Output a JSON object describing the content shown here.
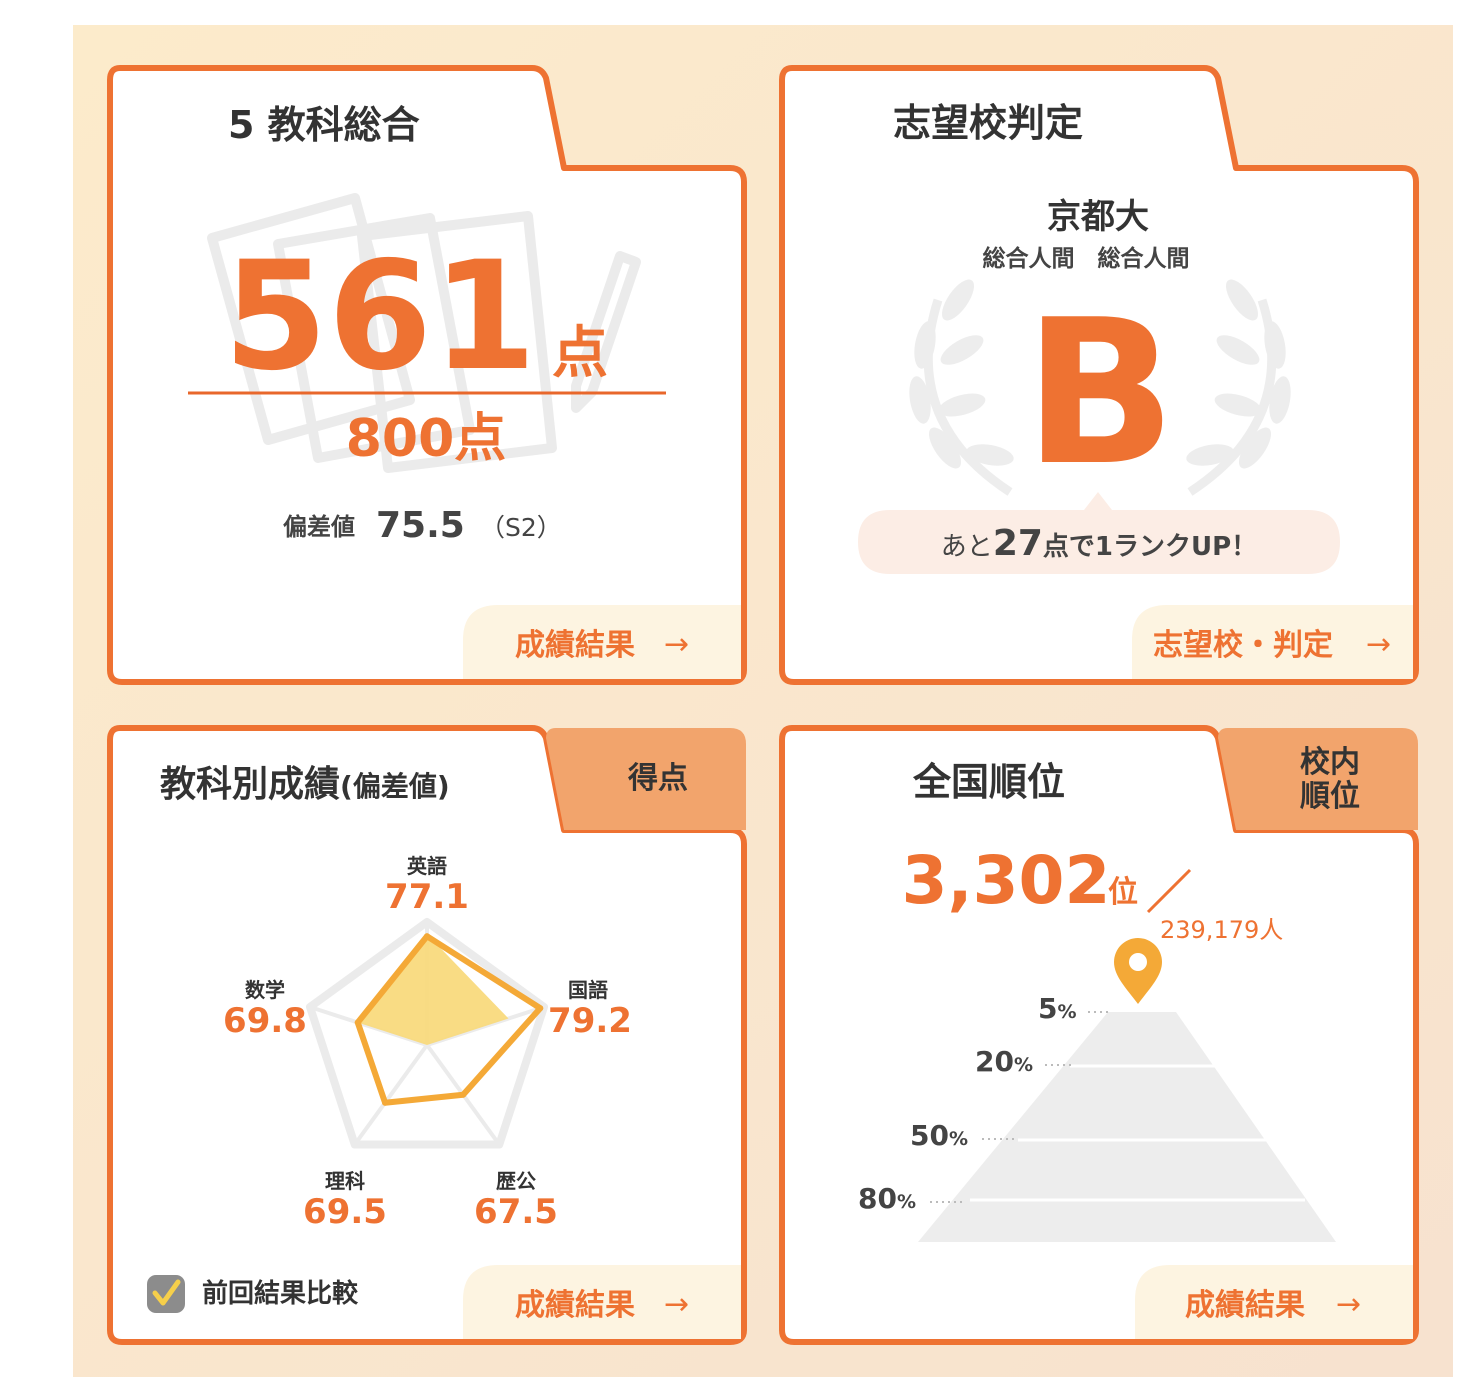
{
  "colors": {
    "accent": "#EE7232",
    "accent_dark": "#E8672B",
    "tab_fill": "#F2A46C",
    "bg": "#FAE9CF",
    "bubble": "#FCEDE5",
    "link_bg": "#FDF4E1",
    "radar_fill": "#F9DA7D",
    "radar_line": "#F4A937",
    "gray": "#EBEBEB"
  },
  "cards": {
    "total": {
      "title": "5 教科総合",
      "score": "561",
      "score_unit": "点",
      "max": "800点",
      "deviation_label": "偏差値",
      "deviation_value": "75.5",
      "rank_code": "（S2）",
      "link": "成績結果",
      "arrow": "→"
    },
    "school": {
      "title": "志望校判定",
      "school_name": "京都大",
      "faculty": "総合人間　総合人間",
      "grade": "B",
      "rank_up_pre": "あと",
      "rank_up_points": "27",
      "rank_up_post": "点で1ランクUP！",
      "link": "志望校・判定",
      "arrow": "→"
    },
    "subjects": {
      "title": "教科別成績",
      "title_sub": "(偏差値)",
      "tab": "得点",
      "compare_label": "前回結果比較",
      "compare_checked": true,
      "link": "成績結果",
      "arrow": "→"
    },
    "ranking": {
      "title": "全国順位",
      "tab_line1": "校内",
      "tab_line2": "順位",
      "rank": "3,302",
      "rank_unit": "位",
      "total": "239,179人",
      "levels": [
        {
          "num": "5",
          "pct": "%"
        },
        {
          "num": "20",
          "pct": "%"
        },
        {
          "num": "50",
          "pct": "%"
        },
        {
          "num": "80",
          "pct": "%"
        }
      ],
      "link": "成績結果",
      "arrow": "→"
    }
  },
  "chart_data": {
    "type": "radar",
    "axes": [
      "英語",
      "国語",
      "歴公",
      "理科",
      "数学"
    ],
    "series": [
      {
        "values": [
          77.1,
          79.2,
          67.5,
          69.5,
          69.8
        ]
      }
    ],
    "labels": [
      "77.1",
      "79.2",
      "67.5",
      "69.5",
      "69.8"
    ]
  }
}
